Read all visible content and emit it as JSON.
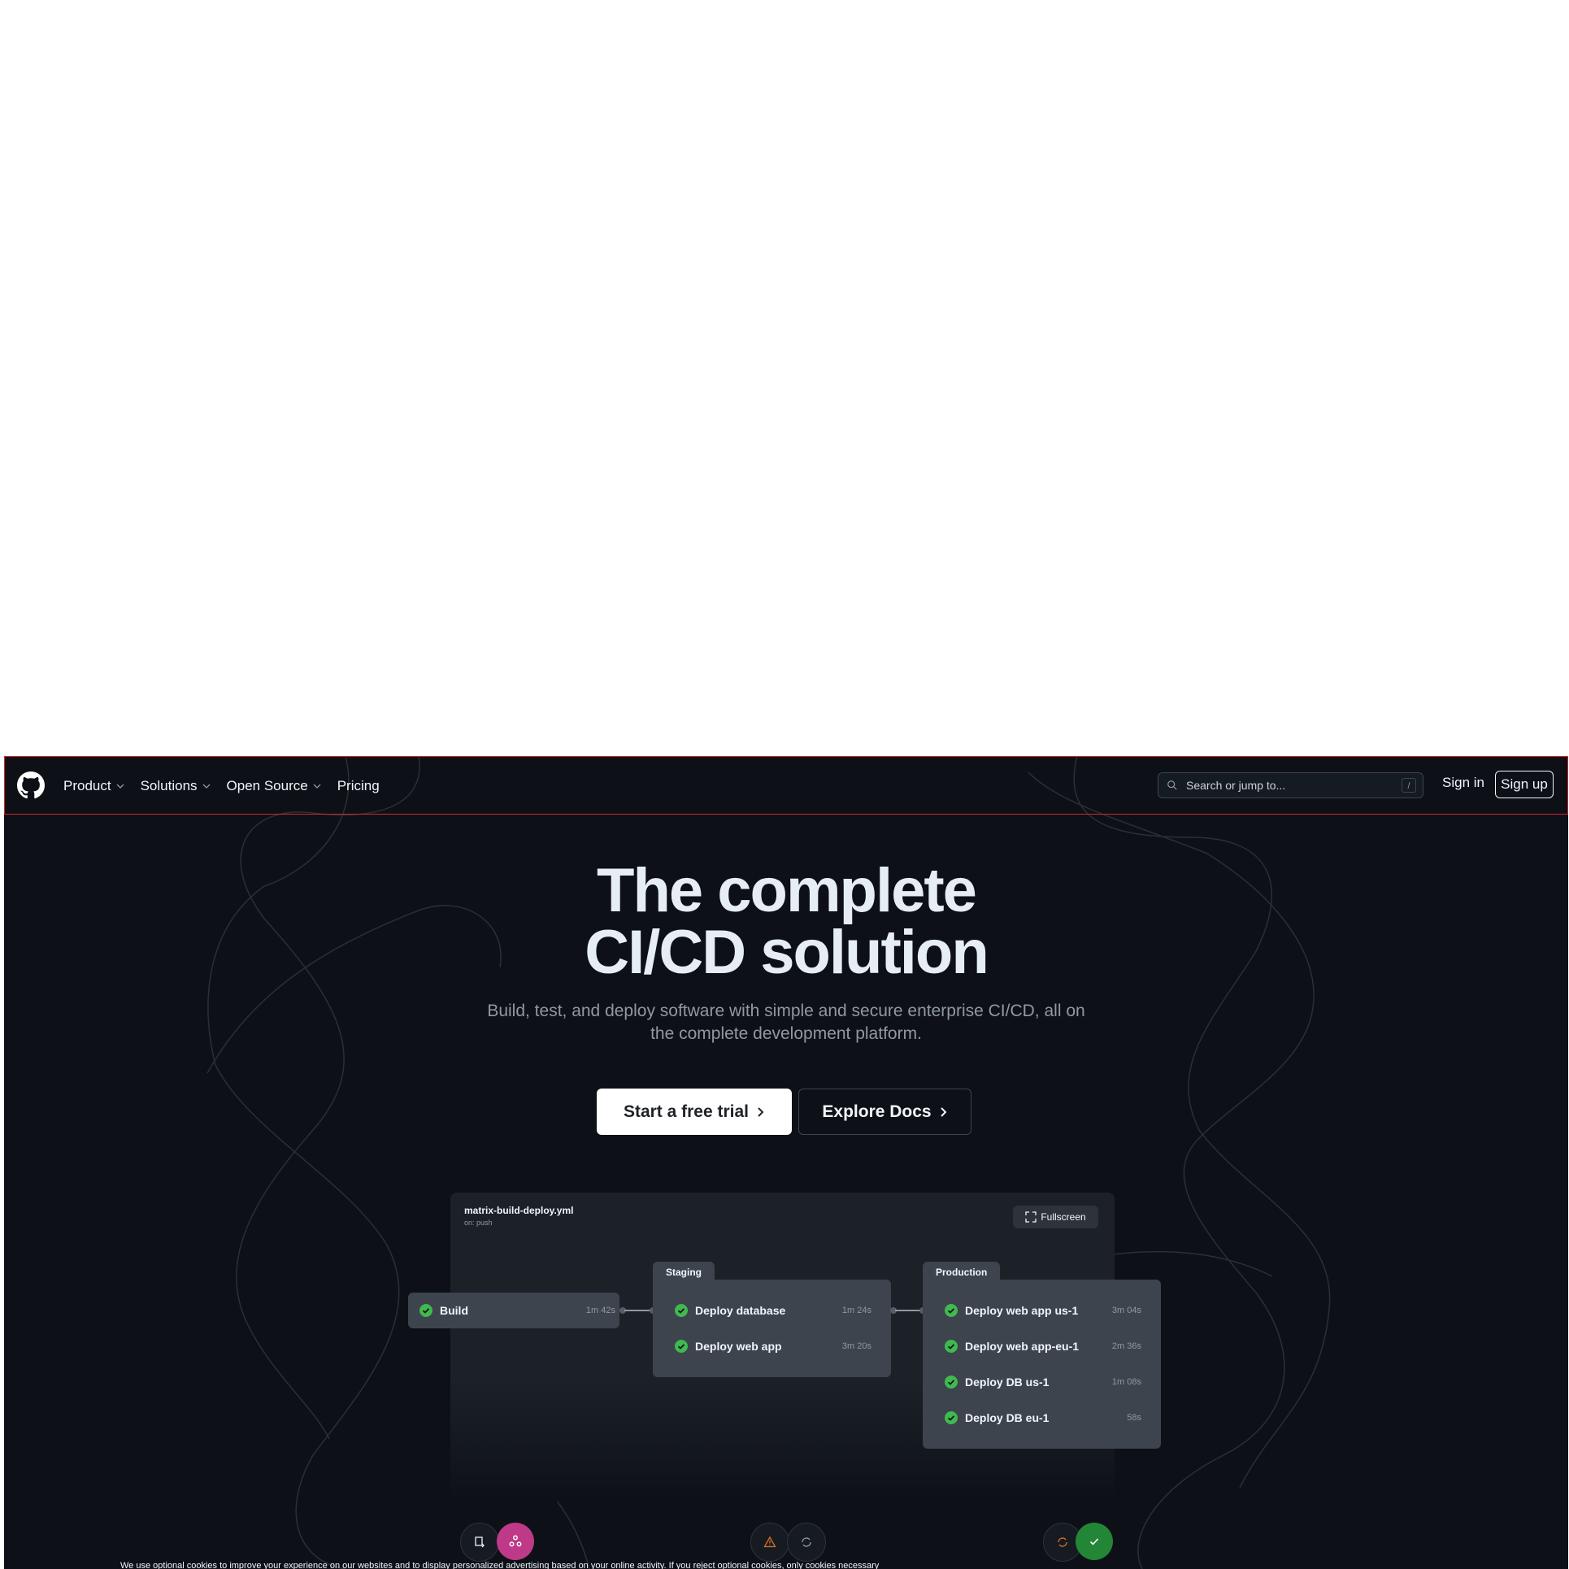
{
  "nav": {
    "items": [
      {
        "label": "Product",
        "dropdown": true
      },
      {
        "label": "Solutions",
        "dropdown": true
      },
      {
        "label": "Open Source",
        "dropdown": true
      },
      {
        "label": "Pricing",
        "dropdown": false
      }
    ],
    "search_placeholder": "Search or jump to...",
    "search_shortcut": "/",
    "sign_in": "Sign in",
    "sign_up": "Sign up"
  },
  "hero": {
    "title_line1": "The complete",
    "title_line2": "CI/CD solution",
    "subtitle": "Build, test, and deploy software with simple and secure enterprise CI/CD, all on the complete development platform.",
    "cta_primary": "Start a free trial",
    "cta_secondary": "Explore Docs"
  },
  "workflow": {
    "file": "matrix-build-deploy.yml",
    "trigger": "on: push",
    "fullscreen_label": "Fullscreen",
    "build": {
      "name": "Build",
      "duration": "1m 42s"
    },
    "staging": {
      "label": "Staging",
      "jobs": [
        {
          "name": "Deploy database",
          "duration": "1m 24s"
        },
        {
          "name": "Deploy web app",
          "duration": "3m 20s"
        }
      ]
    },
    "production": {
      "label": "Production",
      "jobs": [
        {
          "name": "Deploy web app us-1",
          "duration": "3m 04s"
        },
        {
          "name": "Deploy web app-eu-1",
          "duration": "2m 36s"
        },
        {
          "name": "Deploy DB us-1",
          "duration": "1m 08s"
        },
        {
          "name": "Deploy DB eu-1",
          "duration": "58s"
        }
      ]
    }
  },
  "cookie_banner": {
    "text": "We use optional cookies to improve your experience on our websites and to display personalized advertising based on your online activity. If you reject optional cookies, only cookies necessary"
  },
  "colors": {
    "background": "#0d1117",
    "success": "#3fb950",
    "accent_pink": "#bf3989",
    "accent_green": "#238636",
    "warning": "#d29922",
    "danger_orange": "#db6d28",
    "highlight_border": "#d1242f"
  }
}
